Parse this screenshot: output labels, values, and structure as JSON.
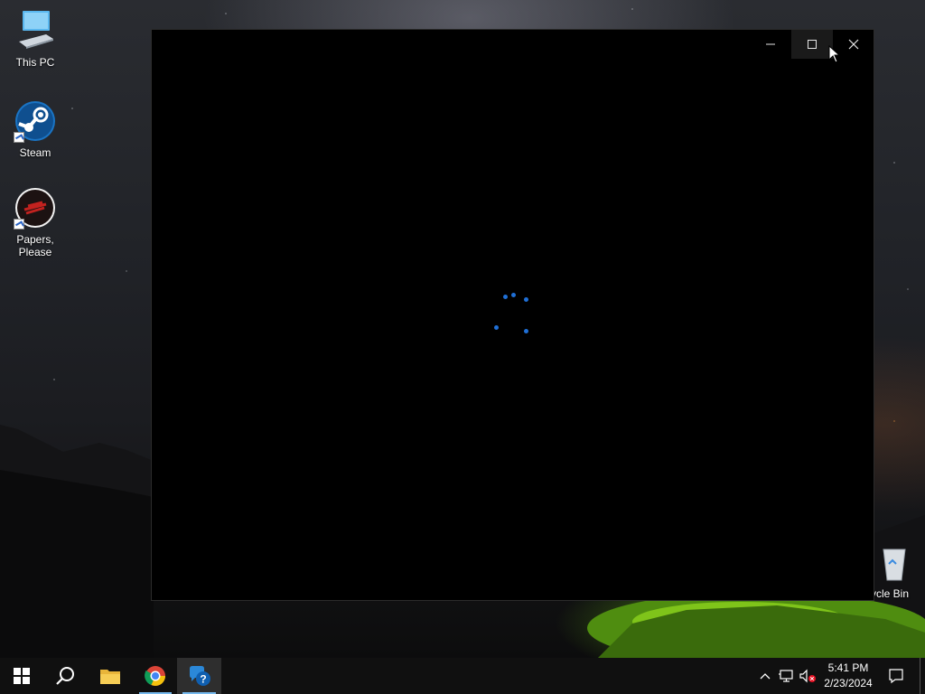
{
  "desktop": {
    "icons": [
      {
        "label": "This PC",
        "icon": "this-pc-icon"
      },
      {
        "label": "Steam",
        "icon": "steam-icon"
      },
      {
        "label": "Papers, Please",
        "icon": "papers-please-icon"
      },
      {
        "label": "cycle Bin",
        "icon": "recycle-bin-icon"
      }
    ]
  },
  "window": {
    "buttons": {
      "minimize": "minimize-icon",
      "maximize": "maximize-icon",
      "close": "close-icon"
    },
    "content": "loading-spinner",
    "accent_color": "#1f6fd6"
  },
  "taskbar": {
    "items": [
      "windows-start-icon",
      "search-icon",
      "file-explorer-icon",
      "chrome-icon",
      "get-help-icon"
    ],
    "active_item": "get-help-icon",
    "tray": [
      "show-hidden-icons-chevron",
      "network-icon",
      "volume-muted-icon"
    ],
    "clock": {
      "time": "5:41 PM",
      "date": "2/23/2024"
    },
    "notifications": "action-center-icon"
  }
}
